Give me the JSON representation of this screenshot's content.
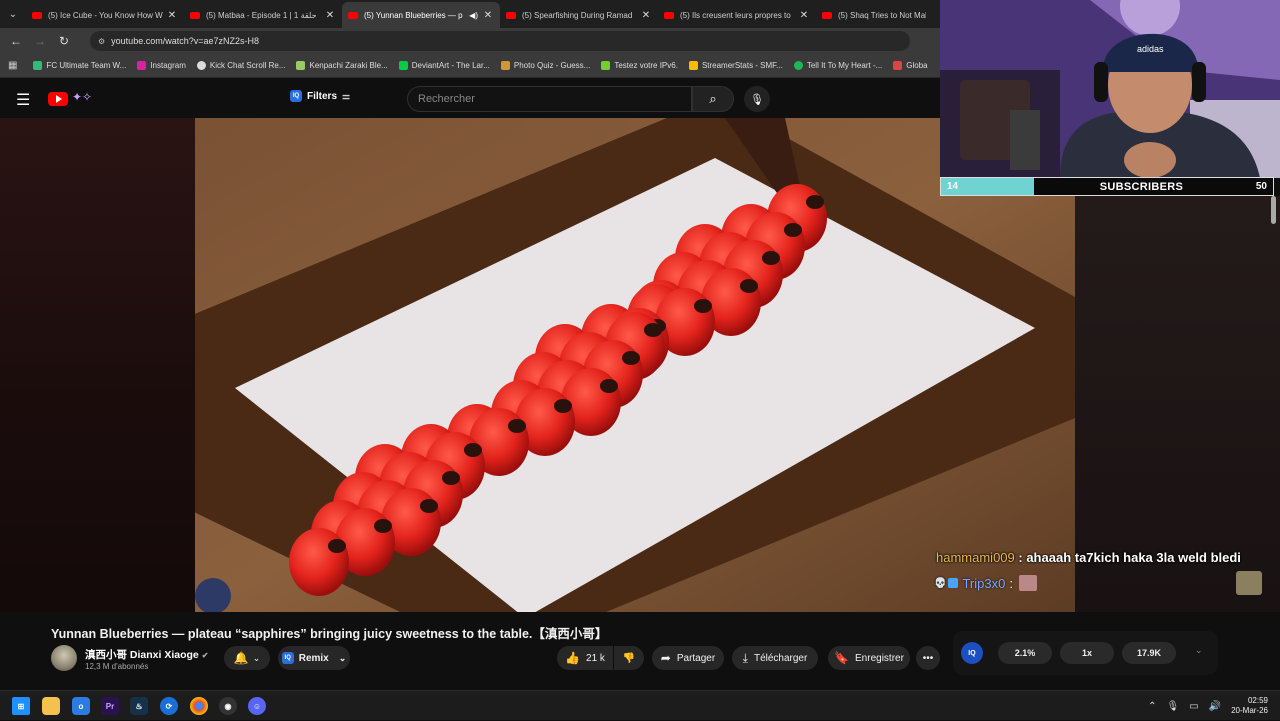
{
  "browser": {
    "tabs": [
      {
        "title": "(5) Ice Cube - You Know How W",
        "active": false
      },
      {
        "title": "(5) Matbaa - Episode 1 | 1 حلقة",
        "active": false
      },
      {
        "title": "(5) Yunnan Blueberries — p",
        "active": true
      },
      {
        "title": "(5) Spearfishing During Ramad",
        "active": false
      },
      {
        "title": "(5) Ils creusent leurs propres to",
        "active": false
      },
      {
        "title": "(5) Shaq Tries to Not Make a",
        "active": false
      }
    ],
    "url": "youtube.com/watch?v=ae7zNZ2s-H8",
    "bookmarks": [
      {
        "label": "FC Ultimate Team W...",
        "color": "#3b7"
      },
      {
        "label": "Instagram",
        "color": "#d6249f"
      },
      {
        "label": "Kick Chat Scroll Re...",
        "color": "#ddd"
      },
      {
        "label": "Kenpachi Zaraki Ble...",
        "color": "#9c6"
      },
      {
        "label": "DeviantArt - The Lar...",
        "color": "#05cc47"
      },
      {
        "label": "Photo Quiz - Guess...",
        "color": "#c93"
      },
      {
        "label": "Testez votre IPv6.",
        "color": "#7c3"
      },
      {
        "label": "StreamerStats - SMF...",
        "color": "#fb0"
      },
      {
        "label": "Tell It To My Heart -...",
        "color": "#1db954"
      },
      {
        "label": "Globa",
        "color": "#d44"
      }
    ]
  },
  "youtube": {
    "filters_label": "Filters",
    "search_placeholder": "Rechercher"
  },
  "video": {
    "title": "Yunnan Blueberries — plateau “sapphires” bringing juicy sweetness to the table.【滇西小哥】",
    "channel": "滇西小哥 Dianxi Xiaoge",
    "subscribers": "12,3 M d'abonnés",
    "remix_label": "Remix",
    "likes": "21 k",
    "share_label": "Partager",
    "download_label": "Télécharger",
    "save_label": "Enregistrer"
  },
  "iq_widget": {
    "logo": "IQ",
    "stat1": "2.1%",
    "stat2": "1x",
    "stat3": "17.9K"
  },
  "stream_overlay": {
    "subscribers_current": "14",
    "subscribers_label": "SUBSCRIBERS",
    "subscribers_goal": "50",
    "subscribers_progress": 0.28,
    "chat": [
      {
        "user": "hammami009",
        "message": "ahaaah ta7kich haka 3la weld bledi"
      },
      {
        "user": "Trip3x0",
        "message": ""
      }
    ]
  },
  "taskbar": {
    "time": "02:59",
    "date": "20-Mar-26"
  },
  "colors": {
    "youtube_red": "#ff0000",
    "sub_bar_fill": "#6fd3d1",
    "chat_user1": "#e6b84e",
    "chat_user2": "#7aa7ff"
  }
}
